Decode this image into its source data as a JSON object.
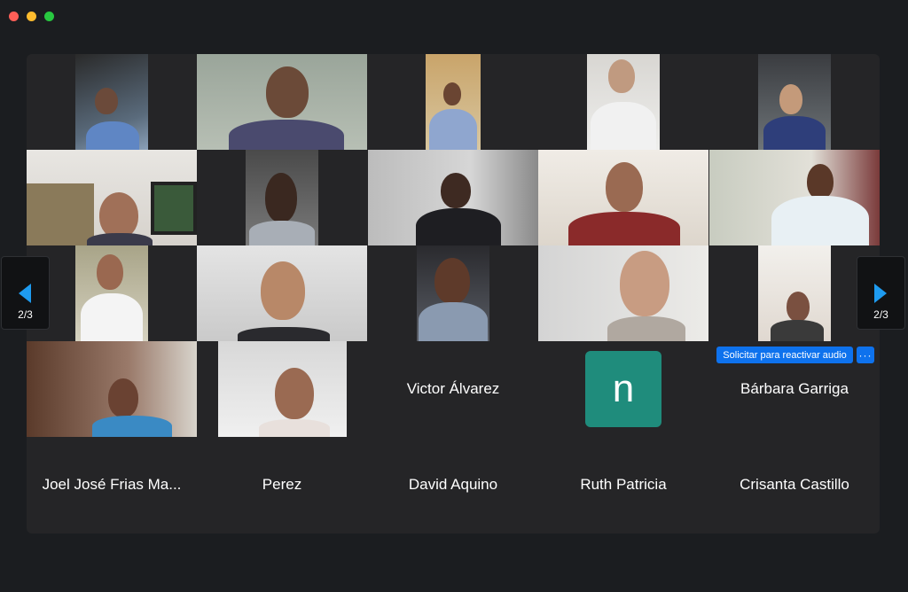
{
  "pagination": {
    "prev_page": "2/3",
    "next_page": "2/3"
  },
  "participants": [
    "Victor Álvarez",
    "n",
    "Bárbara Garriga",
    "Joel José Frias Ma...",
    "Perez",
    "David Aquino",
    "Ruth Patricia",
    "Crisanta Castillo"
  ],
  "actions": {
    "request_unmute": "Solicitar para reactivar audio",
    "more": "···"
  },
  "colors": {
    "avatar_bg": "#1f8c7c",
    "button_blue": "#0e72ed",
    "arrow_blue": "#1e9bf0",
    "panel_bg": "#252527"
  }
}
